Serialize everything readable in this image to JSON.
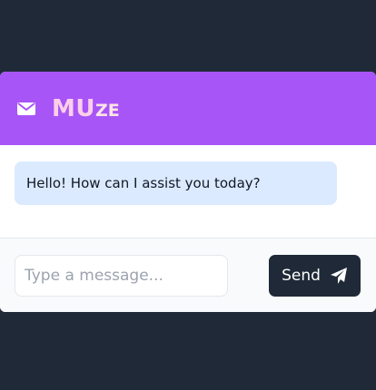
{
  "header": {
    "brand_main": "MU",
    "brand_small": "ZE",
    "icon": "envelope-icon",
    "background": "#a855f7"
  },
  "messages": [
    {
      "sender": "bot",
      "text": "Hello! How can I assist you today?"
    }
  ],
  "composer": {
    "value": "",
    "placeholder": "Type a message...",
    "send_label": "Send",
    "send_icon": "paper-plane-icon"
  },
  "colors": {
    "page_background": "#1f2937",
    "bubble": "#dbeafe",
    "send_button": "#1f2937"
  }
}
